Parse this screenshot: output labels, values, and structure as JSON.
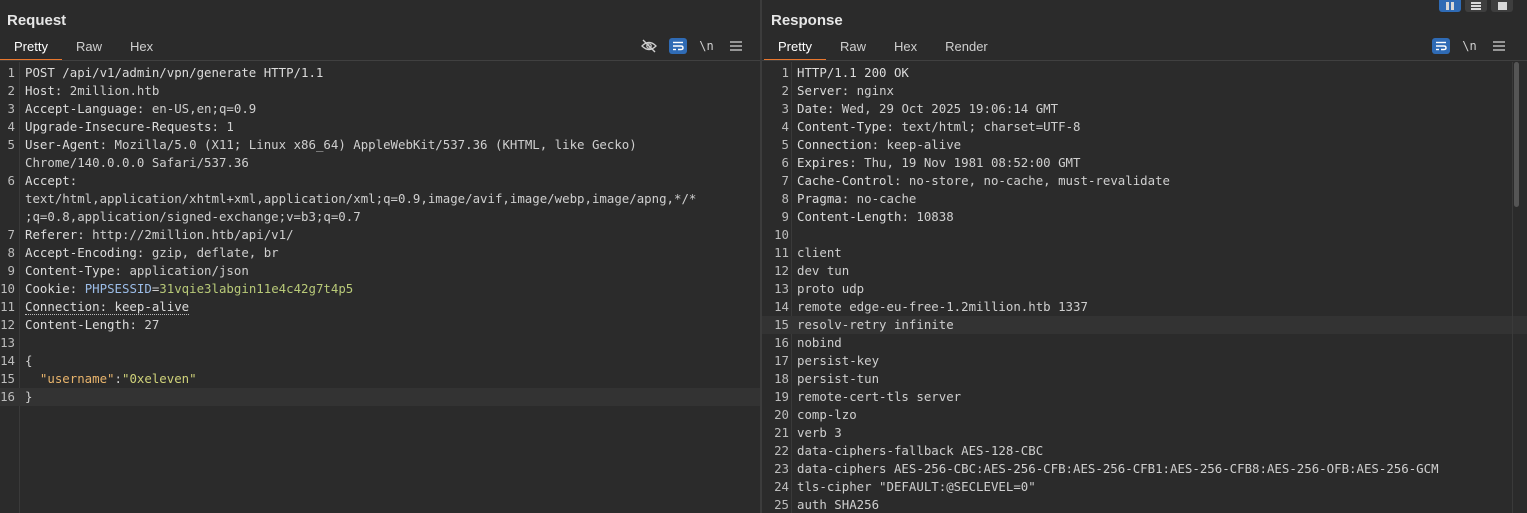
{
  "request": {
    "title": "Request",
    "tabs": [
      "Pretty",
      "Raw",
      "Hex"
    ],
    "tools": {
      "hide_icon": "eye-off-icon",
      "wrap_icon": "wrap-icon",
      "newline_label": "\\n",
      "menu_icon": "menu-icon"
    },
    "lines": [
      {
        "n": "1",
        "parts": [
          {
            "t": "POST /api/v1/admin/vpn/generate HTTP/1.1",
            "c": "hdr"
          }
        ]
      },
      {
        "n": "2",
        "parts": [
          {
            "t": "Host",
            "c": "hdr"
          },
          {
            "t": ": 2million.htb",
            "c": "val"
          }
        ]
      },
      {
        "n": "3",
        "parts": [
          {
            "t": "Accept-Language",
            "c": "hdr"
          },
          {
            "t": ": en-US,en;q=0.9",
            "c": "val"
          }
        ]
      },
      {
        "n": "4",
        "parts": [
          {
            "t": "Upgrade-Insecure-Requests",
            "c": "hdr"
          },
          {
            "t": ": 1",
            "c": "val"
          }
        ]
      },
      {
        "n": "5",
        "parts": [
          {
            "t": "User-Agent",
            "c": "hdr"
          },
          {
            "t": ": Mozilla/5.0 (X11; Linux x86_64) AppleWebKit/537.36 (KHTML, like Gecko)",
            "c": "val"
          }
        ]
      },
      {
        "n": "",
        "parts": [
          {
            "t": "Chrome/140.0.0.0 Safari/537.36",
            "c": "val"
          }
        ]
      },
      {
        "n": "6",
        "parts": [
          {
            "t": "Accept",
            "c": "hdr"
          },
          {
            "t": ":",
            "c": "val"
          }
        ]
      },
      {
        "n": "",
        "parts": [
          {
            "t": "text/html,application/xhtml+xml,application/xml;q=0.9,image/avif,image/webp,image/apng,*/*",
            "c": "val"
          }
        ]
      },
      {
        "n": "",
        "parts": [
          {
            "t": ";q=0.8,application/signed-exchange;v=b3;q=0.7",
            "c": "val"
          }
        ]
      },
      {
        "n": "7",
        "parts": [
          {
            "t": "Referer",
            "c": "hdr"
          },
          {
            "t": ": http://2million.htb/api/v1/",
            "c": "val"
          }
        ]
      },
      {
        "n": "8",
        "parts": [
          {
            "t": "Accept-Encoding",
            "c": "hdr"
          },
          {
            "t": ": gzip, deflate, br",
            "c": "val"
          }
        ]
      },
      {
        "n": "9",
        "parts": [
          {
            "t": "Content-Type",
            "c": "hdr"
          },
          {
            "t": ": application/json",
            "c": "val"
          }
        ]
      },
      {
        "n": "10",
        "parts": [
          {
            "t": "Cookie",
            "c": "hdr"
          },
          {
            "t": ": ",
            "c": "val"
          },
          {
            "t": "PHPSESSID",
            "c": "cookiename"
          },
          {
            "t": "=",
            "c": "val"
          },
          {
            "t": "31vqie3labgin11e4c42g7t4p5",
            "c": "cookieval"
          }
        ]
      },
      {
        "n": "11",
        "parts": [
          {
            "t": "Connection: keep-alive",
            "c": "hdr dotted"
          }
        ]
      },
      {
        "n": "12",
        "parts": [
          {
            "t": "Content-Length",
            "c": "hdr"
          },
          {
            "t": ": 27",
            "c": "val"
          }
        ]
      },
      {
        "n": "13",
        "parts": [
          {
            "t": "",
            "c": "val"
          }
        ]
      },
      {
        "n": "14",
        "parts": [
          {
            "t": "{",
            "c": "val"
          }
        ]
      },
      {
        "n": "15",
        "parts": [
          {
            "t": "  ",
            "c": "val"
          },
          {
            "t": "\"username\"",
            "c": "key"
          },
          {
            "t": ":",
            "c": "val"
          },
          {
            "t": "\"0xeleven\"",
            "c": "sval"
          }
        ]
      },
      {
        "n": "16",
        "parts": [
          {
            "t": "}",
            "c": "val"
          }
        ],
        "hl": true
      }
    ]
  },
  "response": {
    "title": "Response",
    "tabs": [
      "Pretty",
      "Raw",
      "Hex",
      "Render"
    ],
    "tools": {
      "wrap_icon": "wrap-icon",
      "newline_label": "\\n",
      "menu_icon": "menu-icon"
    },
    "lines": [
      {
        "n": "1",
        "parts": [
          {
            "t": "HTTP/1.1 200 OK",
            "c": "hdr"
          }
        ]
      },
      {
        "n": "2",
        "parts": [
          {
            "t": "Server",
            "c": "hdr"
          },
          {
            "t": ": nginx",
            "c": "val"
          }
        ]
      },
      {
        "n": "3",
        "parts": [
          {
            "t": "Date",
            "c": "hdr"
          },
          {
            "t": ": Wed, 29 Oct 2025 19:06:14 GMT",
            "c": "val"
          }
        ]
      },
      {
        "n": "4",
        "parts": [
          {
            "t": "Content-Type",
            "c": "hdr"
          },
          {
            "t": ": text/html; charset=UTF-8",
            "c": "val"
          }
        ]
      },
      {
        "n": "5",
        "parts": [
          {
            "t": "Connection",
            "c": "hdr"
          },
          {
            "t": ": keep-alive",
            "c": "val"
          }
        ]
      },
      {
        "n": "6",
        "parts": [
          {
            "t": "Expires",
            "c": "hdr"
          },
          {
            "t": ": Thu, 19 Nov 1981 08:52:00 GMT",
            "c": "val"
          }
        ]
      },
      {
        "n": "7",
        "parts": [
          {
            "t": "Cache-Control",
            "c": "hdr"
          },
          {
            "t": ": no-store, no-cache, must-revalidate",
            "c": "val"
          }
        ]
      },
      {
        "n": "8",
        "parts": [
          {
            "t": "Pragma",
            "c": "hdr"
          },
          {
            "t": ": no-cache",
            "c": "val"
          }
        ]
      },
      {
        "n": "9",
        "parts": [
          {
            "t": "Content-Length",
            "c": "hdr"
          },
          {
            "t": ": 10838",
            "c": "val"
          }
        ]
      },
      {
        "n": "10",
        "parts": [
          {
            "t": "",
            "c": "val"
          }
        ]
      },
      {
        "n": "11",
        "parts": [
          {
            "t": "client",
            "c": "val"
          }
        ]
      },
      {
        "n": "12",
        "parts": [
          {
            "t": "dev tun",
            "c": "val"
          }
        ]
      },
      {
        "n": "13",
        "parts": [
          {
            "t": "proto udp",
            "c": "val"
          }
        ]
      },
      {
        "n": "14",
        "parts": [
          {
            "t": "remote edge-eu-free-1.2million.htb 1337",
            "c": "val"
          }
        ]
      },
      {
        "n": "15",
        "parts": [
          {
            "t": "resolv-retry infinite",
            "c": "val"
          }
        ],
        "hl": true
      },
      {
        "n": "16",
        "parts": [
          {
            "t": "nobind",
            "c": "val"
          }
        ]
      },
      {
        "n": "17",
        "parts": [
          {
            "t": "persist-key",
            "c": "val"
          }
        ]
      },
      {
        "n": "18",
        "parts": [
          {
            "t": "persist-tun",
            "c": "val"
          }
        ]
      },
      {
        "n": "19",
        "parts": [
          {
            "t": "remote-cert-tls server",
            "c": "val"
          }
        ]
      },
      {
        "n": "20",
        "parts": [
          {
            "t": "comp-lzo",
            "c": "val"
          }
        ]
      },
      {
        "n": "21",
        "parts": [
          {
            "t": "verb 3",
            "c": "val"
          }
        ]
      },
      {
        "n": "22",
        "parts": [
          {
            "t": "data-ciphers-fallback AES-128-CBC",
            "c": "val"
          }
        ]
      },
      {
        "n": "23",
        "parts": [
          {
            "t": "data-ciphers AES-256-CBC:AES-256-CFB:AES-256-CFB1:AES-256-CFB8:AES-256-OFB:AES-256-GCM",
            "c": "val"
          }
        ]
      },
      {
        "n": "24",
        "parts": [
          {
            "t": "tls-cipher \"DEFAULT:@SECLEVEL=0\"",
            "c": "val"
          }
        ]
      },
      {
        "n": "25",
        "parts": [
          {
            "t": "auth SHA256",
            "c": "val"
          }
        ]
      }
    ]
  },
  "layout_buttons": [
    "split-horizontal-icon",
    "split-vertical-icon",
    "single-pane-icon"
  ]
}
